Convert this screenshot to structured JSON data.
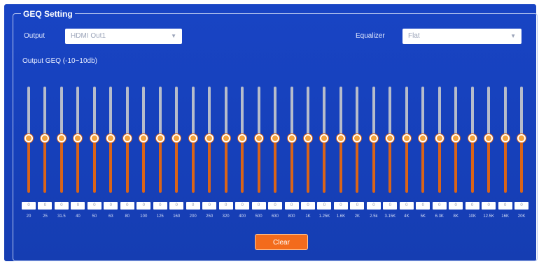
{
  "section_title": "GEQ Setting",
  "output": {
    "label": "Output",
    "value": "HDMI Out1"
  },
  "equalizer": {
    "label": "Equalizer",
    "value": "Flat"
  },
  "geq_label": "Output GEQ (-10~10db)",
  "colors": {
    "panel": "#1844c4",
    "accent": "#f36b1c",
    "track_fill": "#d96418",
    "track_empty": "#b6bccb"
  },
  "bands": [
    {
      "freq": "20",
      "value": "0"
    },
    {
      "freq": "25",
      "value": "0"
    },
    {
      "freq": "31.5",
      "value": "0"
    },
    {
      "freq": "40",
      "value": "0"
    },
    {
      "freq": "50",
      "value": "0"
    },
    {
      "freq": "63",
      "value": "0"
    },
    {
      "freq": "80",
      "value": "0"
    },
    {
      "freq": "100",
      "value": "0"
    },
    {
      "freq": "125",
      "value": "0"
    },
    {
      "freq": "160",
      "value": "0"
    },
    {
      "freq": "200",
      "value": "0"
    },
    {
      "freq": "250",
      "value": "0"
    },
    {
      "freq": "320",
      "value": "0"
    },
    {
      "freq": "400",
      "value": "0"
    },
    {
      "freq": "500",
      "value": "0"
    },
    {
      "freq": "630",
      "value": "0"
    },
    {
      "freq": "800",
      "value": "0"
    },
    {
      "freq": "1K",
      "value": "0"
    },
    {
      "freq": "1.25K",
      "value": "0"
    },
    {
      "freq": "1.6K",
      "value": "0"
    },
    {
      "freq": "2K",
      "value": "0"
    },
    {
      "freq": "2.5k",
      "value": "0"
    },
    {
      "freq": "3.15K",
      "value": "0"
    },
    {
      "freq": "4K",
      "value": "0"
    },
    {
      "freq": "5K",
      "value": "0"
    },
    {
      "freq": "6.3K",
      "value": "0"
    },
    {
      "freq": "8K",
      "value": "0"
    },
    {
      "freq": "10K",
      "value": "0"
    },
    {
      "freq": "12.5K",
      "value": "0"
    },
    {
      "freq": "16K",
      "value": "0"
    },
    {
      "freq": "20K",
      "value": "0"
    }
  ],
  "clear_label": "Clear"
}
